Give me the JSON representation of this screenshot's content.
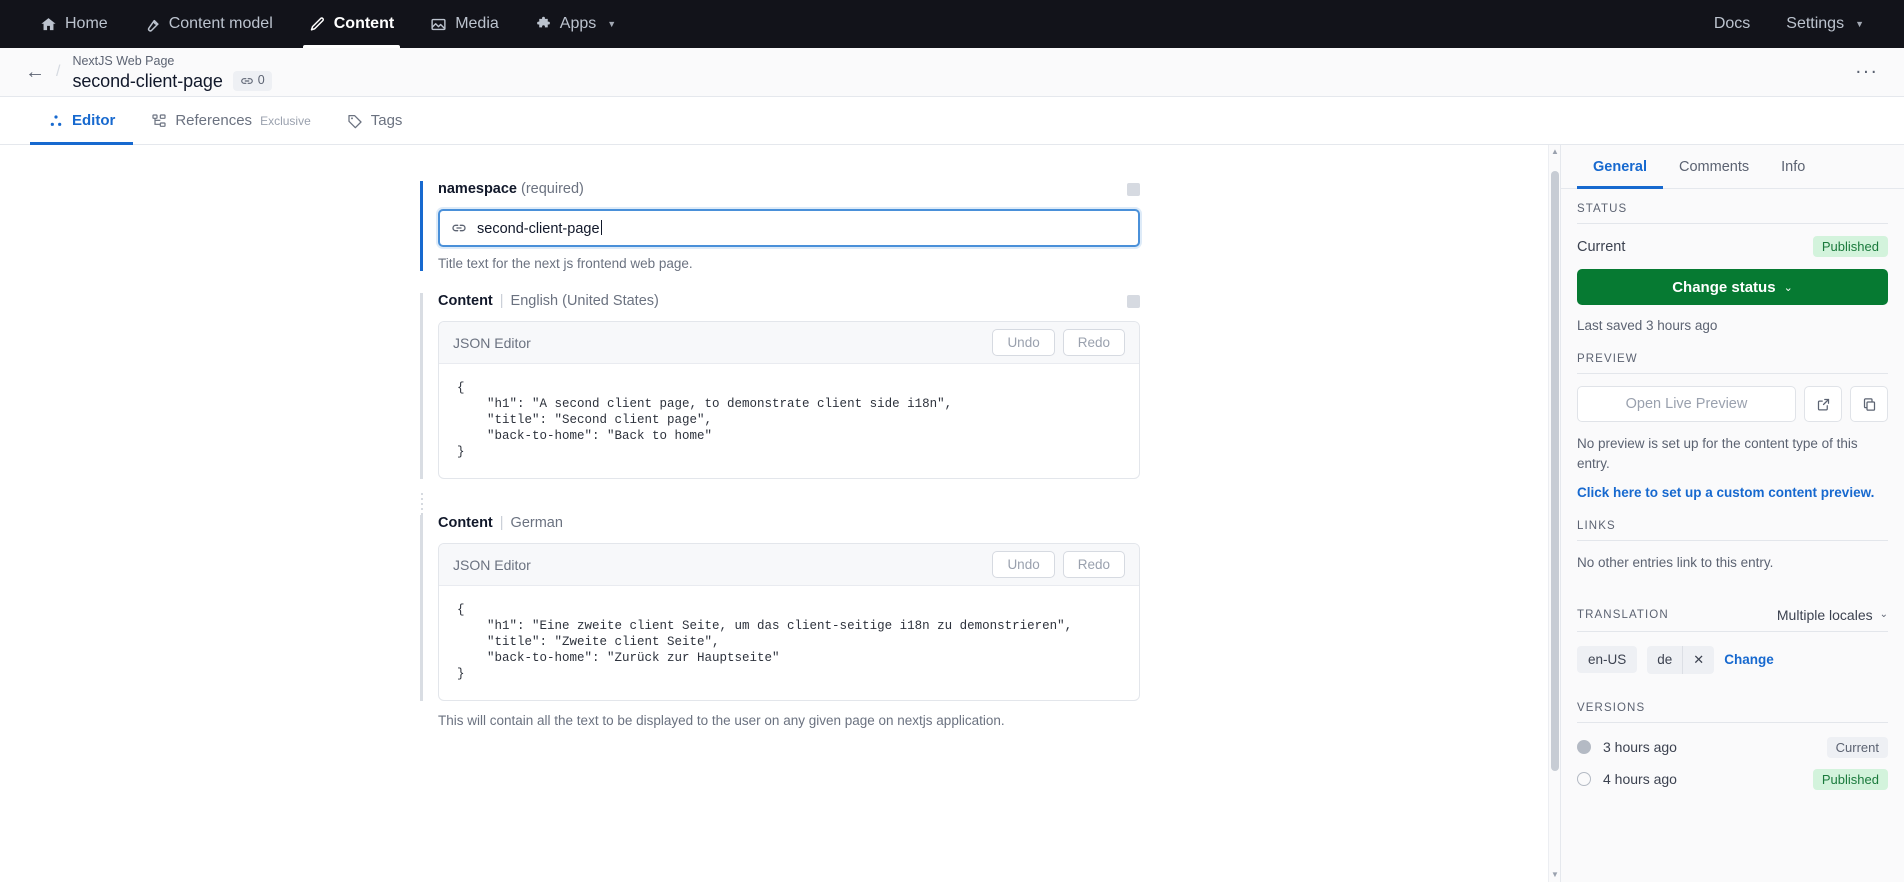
{
  "topnav": {
    "items": [
      {
        "label": "Home",
        "icon": "home-icon",
        "active": false
      },
      {
        "label": "Content model",
        "icon": "wrench-icon",
        "active": false
      },
      {
        "label": "Content",
        "icon": "pen-icon",
        "active": true
      },
      {
        "label": "Media",
        "icon": "image-icon",
        "active": false
      },
      {
        "label": "Apps",
        "icon": "puzzle-icon",
        "active": false,
        "caret": true
      }
    ],
    "right": [
      {
        "label": "Docs"
      },
      {
        "label": "Settings",
        "caret": true
      }
    ]
  },
  "entry_header": {
    "content_type": "NextJS Web Page",
    "title": "second-client-page",
    "links_count": "0",
    "overflow": "···"
  },
  "tabs": [
    {
      "label": "Editor",
      "icon": "editor-icon",
      "active": true,
      "sub": ""
    },
    {
      "label": "References",
      "icon": "references-icon",
      "active": false,
      "sub": "Exclusive"
    },
    {
      "label": "Tags",
      "icon": "tag-icon",
      "active": false,
      "sub": ""
    }
  ],
  "fields": {
    "namespace": {
      "label": "namespace",
      "required_text": "(required)",
      "value": "second-client-page",
      "help": "Title text for the next js frontend web page."
    },
    "content_en": {
      "label": "Content",
      "locale": "English (United States)",
      "editor_title": "JSON Editor",
      "undo": "Undo",
      "redo": "Redo",
      "json": "{\n    \"h1\": \"A second client page, to demonstrate client side i18n\",\n    \"title\": \"Second client page\",\n    \"back-to-home\": \"Back to home\"\n}"
    },
    "content_de": {
      "label": "Content",
      "locale": "German",
      "editor_title": "JSON Editor",
      "undo": "Undo",
      "redo": "Redo",
      "json": "{\n    \"h1\": \"Eine zweite client Seite, um das client-seitige i18n zu demonstrieren\",\n    \"title\": \"Zweite client Seite\",\n    \"back-to-home\": \"Zurück zur Hauptseite\"\n}"
    },
    "bottom_help": "This will contain all the text to be displayed to the user on any given page on nextjs application."
  },
  "sidebar": {
    "tabs": [
      {
        "label": "General",
        "active": true
      },
      {
        "label": "Comments",
        "active": false
      },
      {
        "label": "Info",
        "active": false
      }
    ],
    "status": {
      "title": "STATUS",
      "current_label": "Current",
      "current_value": "Published",
      "change_button": "Change status",
      "last_saved": "Last saved 3 hours ago"
    },
    "preview": {
      "title": "PREVIEW",
      "button": "Open Live Preview",
      "note": "No preview is set up for the content type of this entry.",
      "link": "Click here to set up a custom content preview."
    },
    "links": {
      "title": "LINKS",
      "note": "No other entries link to this entry."
    },
    "translation": {
      "title": "TRANSLATION",
      "selector": "Multiple locales",
      "locales": [
        "en-US",
        "de"
      ],
      "change": "Change"
    },
    "versions": {
      "title": "VERSIONS",
      "items": [
        {
          "time": "3 hours ago",
          "badge": "Current",
          "badge_type": "current",
          "selected": true
        },
        {
          "time": "4 hours ago",
          "badge": "Published",
          "badge_type": "published",
          "selected": false
        }
      ]
    }
  },
  "colors": {
    "accent": "#1769cf",
    "published_green": "#067a32",
    "topbar": "#12131a"
  }
}
